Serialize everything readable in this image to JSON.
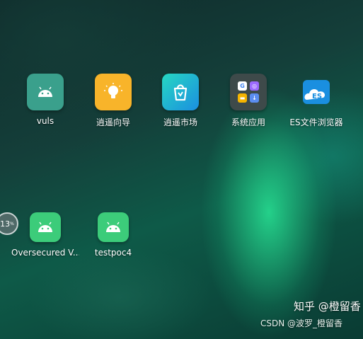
{
  "home_screen": {
    "row1": [
      {
        "label": "vuls",
        "icon": "android-icon"
      },
      {
        "label": "逍遥向导",
        "icon": "lightbulb-icon"
      },
      {
        "label": "逍遥市场",
        "icon": "shopping-bag-icon"
      },
      {
        "label": "系统应用",
        "icon": "folder-icon"
      },
      {
        "label": "ES文件浏览器",
        "icon": "es-cloud-icon"
      }
    ],
    "row2": [
      {
        "label": "Oversecured V...",
        "icon": "android-icon"
      },
      {
        "label": "testpoc4",
        "icon": "android-icon"
      }
    ]
  },
  "progress": {
    "value": "13",
    "unit": "%",
    "percent": 13
  },
  "watermark": {
    "zhihu": "知乎 @橙留香",
    "csdn": "CSDN @波罗_橙留香"
  },
  "colors": {
    "android": "#3ddc84",
    "bulb": "#f8b42a",
    "accent": "#1b8fe0"
  }
}
